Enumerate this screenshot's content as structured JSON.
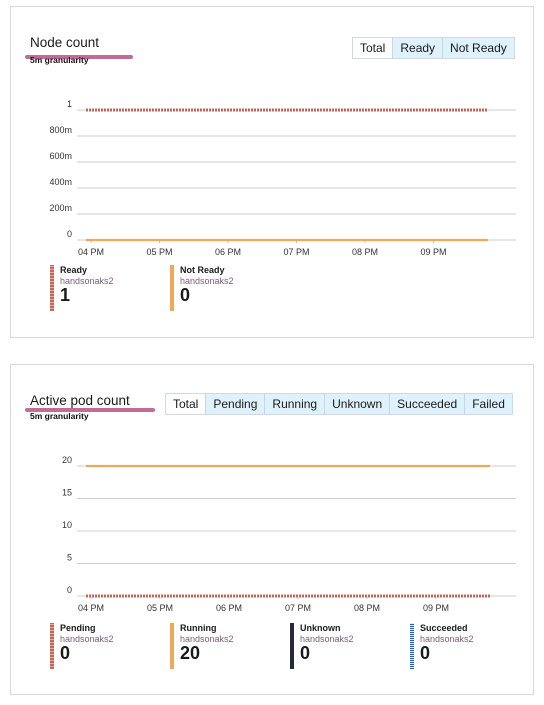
{
  "node_panel": {
    "title": "Node count",
    "granularity": "5m granularity",
    "tabs": [
      "Total",
      "Ready",
      "Not Ready"
    ],
    "active_tab": "Total",
    "chart_data": {
      "type": "line",
      "title": "",
      "xlabel": "",
      "ylabel": "",
      "x_ticks": [
        "04 PM",
        "05 PM",
        "06 PM",
        "07 PM",
        "08 PM",
        "09 PM"
      ],
      "y_ticks": [
        "1",
        "800m",
        "600m",
        "400m",
        "200m",
        "0"
      ],
      "ylim": [
        0,
        1
      ],
      "series": [
        {
          "name": "Ready",
          "color": "#c0685a",
          "style": "hatched",
          "values": [
            1,
            1,
            1,
            1,
            1,
            1,
            1
          ]
        },
        {
          "name": "Not Ready",
          "color": "#f0a85a",
          "style": "solid",
          "values": [
            0,
            0,
            0,
            0,
            0,
            0,
            0
          ]
        }
      ]
    },
    "legend": [
      {
        "name": "Ready",
        "sub": "handsonaks2",
        "value": "1",
        "style": "hatch-red"
      },
      {
        "name": "Not Ready",
        "sub": "handsonaks2",
        "value": "0",
        "style": "solid-orange"
      }
    ]
  },
  "pod_panel": {
    "title": "Active pod count",
    "granularity": "5m granularity",
    "tabs": [
      "Total",
      "Pending",
      "Running",
      "Unknown",
      "Succeeded",
      "Failed"
    ],
    "active_tab": "Total",
    "chart_data": {
      "type": "line",
      "title": "",
      "xlabel": "",
      "ylabel": "",
      "x_ticks": [
        "04 PM",
        "05 PM",
        "06 PM",
        "07 PM",
        "08 PM",
        "09 PM"
      ],
      "y_ticks": [
        "20",
        "15",
        "10",
        "5",
        "0"
      ],
      "ylim": [
        0,
        20
      ],
      "series": [
        {
          "name": "Pending",
          "color": "#c0685a",
          "style": "hatched",
          "values": [
            0,
            0,
            0,
            0,
            0,
            0,
            0
          ]
        },
        {
          "name": "Running",
          "color": "#f0a85a",
          "style": "solid",
          "values": [
            20,
            20,
            20,
            20,
            20,
            20,
            20
          ]
        },
        {
          "name": "Unknown",
          "color": "#262a3a",
          "style": "solid",
          "values": [
            0,
            0,
            0,
            0,
            0,
            0,
            0
          ]
        },
        {
          "name": "Succeeded",
          "color": "#2b5fa8",
          "style": "hatched",
          "values": [
            0,
            0,
            0,
            0,
            0,
            0,
            0
          ]
        }
      ]
    },
    "legend": [
      {
        "name": "Pending",
        "sub": "handsonaks2",
        "value": "0",
        "style": "hatch-red"
      },
      {
        "name": "Running",
        "sub": "handsonaks2",
        "value": "20",
        "style": "solid-orange"
      },
      {
        "name": "Unknown",
        "sub": "handsonaks2",
        "value": "0",
        "style": "solid-navy"
      },
      {
        "name": "Succeeded",
        "sub": "handsonaks2",
        "value": "0",
        "style": "hatch-blue"
      }
    ]
  }
}
